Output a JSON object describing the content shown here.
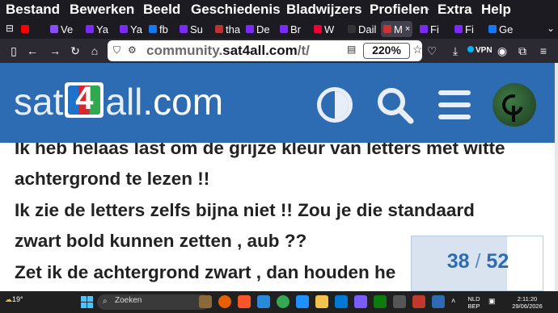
{
  "menubar": {
    "items": [
      {
        "label": "Bestand"
      },
      {
        "label": "Bewerken"
      },
      {
        "label": "Beeld"
      },
      {
        "label": "Geschiedenis"
      },
      {
        "label": "Bladwijzers"
      },
      {
        "label": "Profielen"
      },
      {
        "label": "Extra"
      },
      {
        "label": "Help"
      }
    ]
  },
  "tabs": [
    {
      "label": "",
      "color": "#ff0000"
    },
    {
      "label": "Ve",
      "color": "#8a4cff"
    },
    {
      "label": "Ya",
      "color": "#7b2bf9"
    },
    {
      "label": "Ya",
      "color": "#7b2bf9"
    },
    {
      "label": "fb",
      "color": "#1877f2"
    },
    {
      "label": "Su",
      "color": "#7b2bf9"
    },
    {
      "label": "tha",
      "color": "#b33"
    },
    {
      "label": "De",
      "color": "#7b2bf9"
    },
    {
      "label": "Br",
      "color": "#7b2bf9"
    },
    {
      "label": "W",
      "color": "#e03"
    },
    {
      "label": "Dail",
      "color": "#333"
    },
    {
      "label": "M",
      "color": "#c33",
      "active": true
    },
    {
      "label": "Fi",
      "color": "#7b2bf9"
    },
    {
      "label": "Fi",
      "color": "#7b2bf9"
    },
    {
      "label": "Ge",
      "color": "#1877f2"
    }
  ],
  "toolbar": {
    "url_prefix": "community.",
    "url_domain": "sat4all.com",
    "url_suffix": "/t/",
    "zoom": "220%",
    "vpn_label": "VPN"
  },
  "header": {
    "logo_pre": "sat",
    "logo_num": "4",
    "logo_post": "all",
    "logo_tld": ".com"
  },
  "post": {
    "lines": [
      "Ik heb helaas last om de grijze kleur van letters met witte",
      "achtergrond te lezen !!",
      "Ik zie de letters zelfs bijna niet !! Zou je die standaard",
      "zwart bold kunnen zetten , aub ??",
      "Zet ik de achtergrond zwart , dan houden he"
    ]
  },
  "progress": {
    "current": "38",
    "separator": "/",
    "total": "52",
    "fraction": 0.73
  },
  "taskbar": {
    "weather": "19°",
    "search_placeholder": "Zoeken",
    "lang_top": "NLD",
    "lang_bottom": "BEP",
    "time": "2:11:20",
    "date": "29/06/2026"
  }
}
